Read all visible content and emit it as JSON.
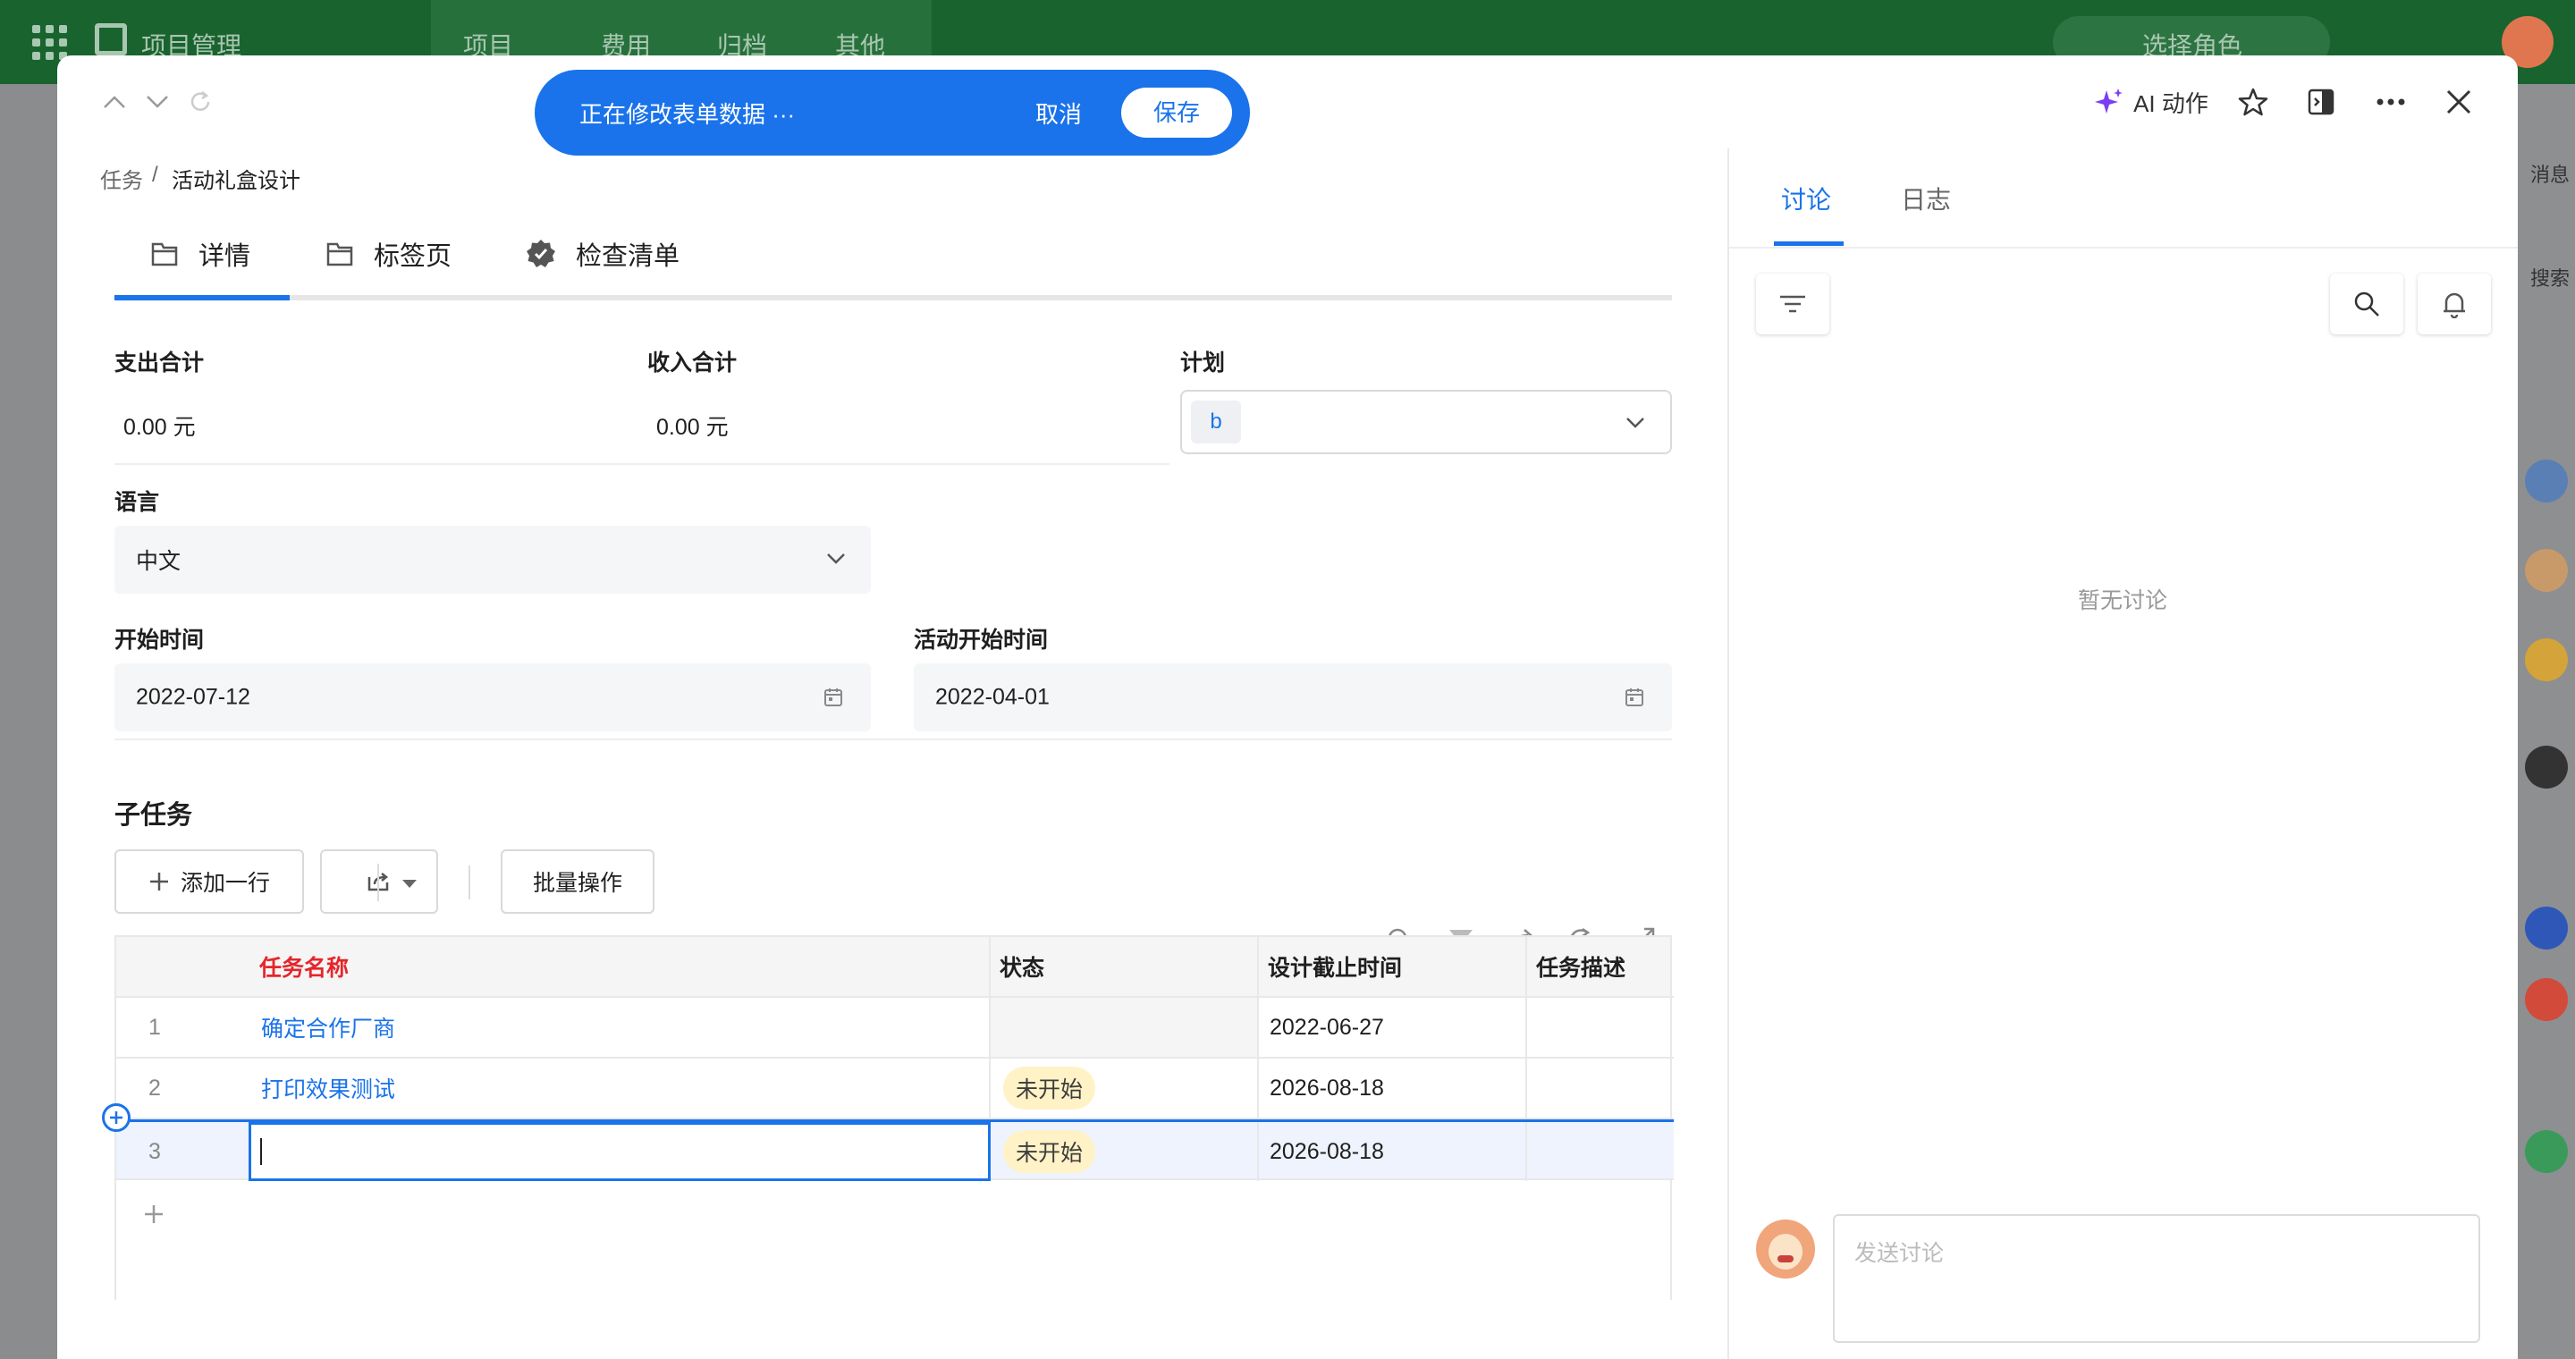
{
  "app": {
    "title": "项目管理",
    "nav": [
      "项目",
      "费用",
      "归档",
      "其他"
    ],
    "role_select": "选择角色",
    "right_hint_1": "消息",
    "right_hint_2": "搜索"
  },
  "save_bar": {
    "message": "正在修改表单数据 ···",
    "cancel": "取消",
    "save": "保存"
  },
  "header": {
    "ai_action": "AI 动作"
  },
  "breadcrumb": {
    "parent": "任务",
    "separator": "/",
    "current": "活动礼盒设计"
  },
  "tabs": [
    "详情",
    "标签页",
    "检查清单"
  ],
  "form": {
    "expense_total": {
      "label": "支出合计",
      "value": "0.00 元"
    },
    "income_total": {
      "label": "收入合计",
      "value": "0.00 元"
    },
    "plan": {
      "label": "计划",
      "value": "b"
    },
    "language": {
      "label": "语言",
      "value": "中文"
    },
    "start_time": {
      "label": "开始时间",
      "value": "2022-07-12"
    },
    "activity_start": {
      "label": "活动开始时间",
      "value": "2022-04-01"
    }
  },
  "subtasks": {
    "title": "子任务",
    "add_row": "添加一行",
    "batch": "批量操作",
    "columns": [
      "任务名称",
      "状态",
      "设计截止时间",
      "任务描述"
    ],
    "rows": [
      {
        "no": "1",
        "name": "确定合作厂商",
        "status": "",
        "deadline": "2022-06-27",
        "desc": ""
      },
      {
        "no": "2",
        "name": "打印效果测试",
        "status": "未开始",
        "deadline": "2026-08-18",
        "desc": ""
      },
      {
        "no": "3",
        "name": "",
        "status": "未开始",
        "deadline": "2026-08-18",
        "desc": ""
      }
    ]
  },
  "discussion": {
    "tabs": [
      "讨论",
      "日志"
    ],
    "empty": "暂无讨论",
    "input_placeholder": "发送讨论"
  },
  "colors": {
    "accent": "#1a73ea",
    "required": "#e5252a",
    "topbar": "#19632f",
    "status_badge": "#fff2c6"
  }
}
